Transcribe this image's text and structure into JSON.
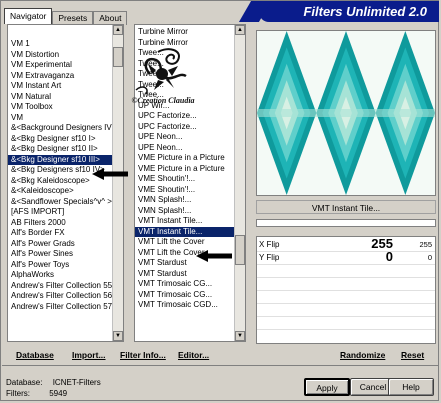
{
  "banner": "Filters Unlimited 2.0",
  "tabs": [
    {
      "label": "Navigator"
    },
    {
      "label": "Presets"
    },
    {
      "label": "About"
    }
  ],
  "categories": [
    "VM 1",
    "VM Distortion",
    "VM Experimental",
    "VM Extravaganza",
    "VM Instant Art",
    "VM Natural",
    "VM Toolbox",
    "VM",
    "&<Background Designers IV>",
    "&<Bkg Designer sf10 I>",
    "&<Bkg Designer sf10 II>",
    "&<Bkg Designer sf10 III>",
    "&<Bkg Designers sf10 IV>",
    "&<Bkg Kaleidoscope>",
    "&<Kaleidoscope>",
    "&<Sandflower Specials^v^ >",
    "[AFS IMPORT]",
    "AB Filters 2000",
    "Alf's Border FX",
    "Alf's Power Grads",
    "Alf's Power Sines",
    "Alf's Power Toys",
    "AlphaWorks",
    "Andrew's Filter Collection 55",
    "Andrew's Filter Collection 56",
    "Andrew's Filter Collection 57"
  ],
  "category_selected_index": 11,
  "filters": [
    "Turbine Mirror",
    "Turbine Mirror",
    "Twee...",
    "Twee...",
    "Twee...",
    "Twee...",
    "Twee...",
    "UP Wir...",
    "UPC Factorize...",
    "UPC Factorize...",
    "UPE Neon...",
    "UPE Neon...",
    "VME Picture in a Picture",
    "VME Picture in a Picture",
    "VME Shoutin'!...",
    "VME Shoutin'!...",
    "VMN Splash!...",
    "VMN Splash!...",
    "VMT Instant Tile...",
    "VMT Instant Tile...",
    "VMT Lift the Cover",
    "VMT Lift the Cover",
    "VMT Stardust",
    "VMT Stardust",
    "VMT Trimosaic CG...",
    "VMT Trimosaic CG...",
    "VMT Trimosaic CGD..."
  ],
  "filter_selected_index": 19,
  "watermark_text": "©Creation Claudia",
  "preview": {
    "colors": [
      "#0f9a9c",
      "#1eb4b6",
      "#5fcfcb",
      "#a6e3d6",
      "#d8f0e4",
      "#f4faf6"
    ]
  },
  "current_filter": "VMT Instant Tile...",
  "params": [
    {
      "label": "X Flip",
      "value": "255",
      "max": "255"
    },
    {
      "label": "Y Flip",
      "value": "0",
      "max": "0"
    }
  ],
  "links": {
    "database": "Database",
    "import": "Import...",
    "filter_info": "Filter Info...",
    "editor": "Editor...",
    "randomize": "Randomize",
    "reset": "Reset"
  },
  "status": {
    "database_label": "Database:",
    "database_value": "ICNET-Filters",
    "filters_label": "Filters:",
    "filters_value": "5949"
  },
  "buttons": {
    "apply": "Apply",
    "cancel": "Cancel",
    "help": "Help"
  }
}
